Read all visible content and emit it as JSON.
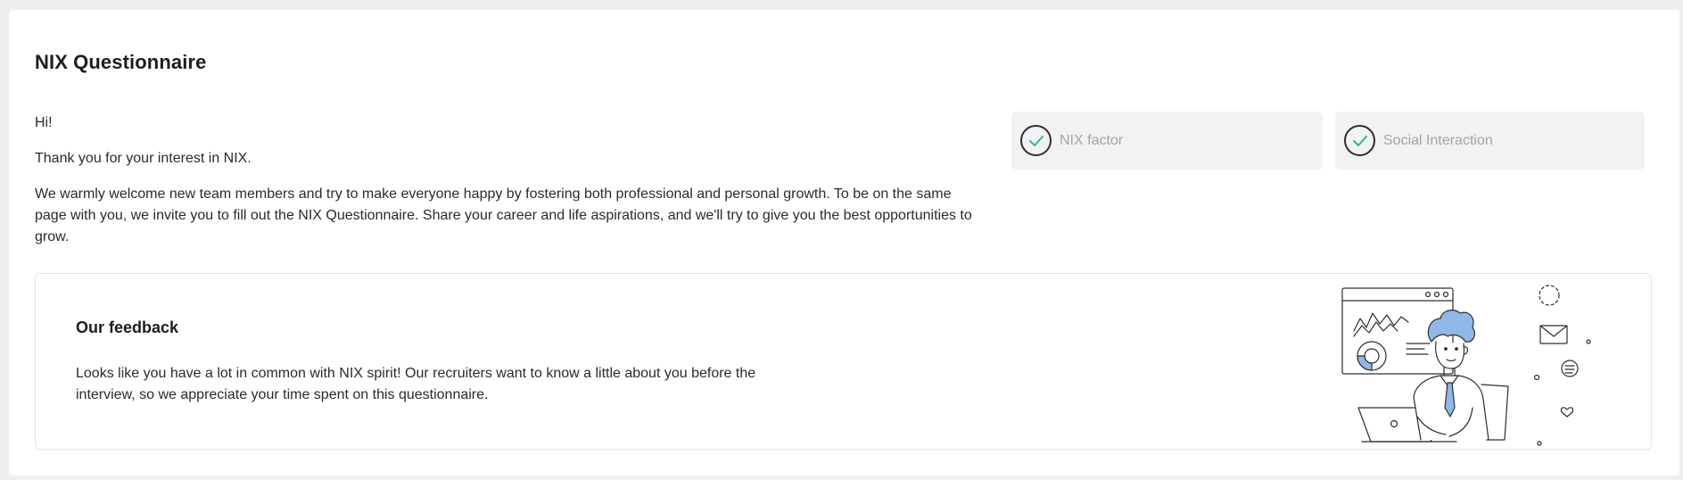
{
  "page": {
    "title": "NIX Questionnaire"
  },
  "intro": {
    "greeting": "Hi!",
    "thanks": "Thank you for your interest in NIX.",
    "body": "We warmly welcome new team members and try to make everyone happy by fostering both professional and personal growth. To be on the same page with you, we invite you to fill out the NIX Questionnaire. Share your career and life aspirations, and we'll try to give you the best opportunities to grow."
  },
  "status_chips": [
    {
      "label": "NIX factor",
      "icon": "check-circle-icon",
      "state": "completed"
    },
    {
      "label": "Social Interaction",
      "icon": "check-circle-icon",
      "state": "completed"
    }
  ],
  "feedback": {
    "title": "Our feedback",
    "text": "Looks like you have a lot in common with NIX spirit! Our recruiters want to know a little about you before the interview, so we appreciate your time spent on this questionnaire.",
    "illustration": "person-at-laptop-illustration"
  },
  "colors": {
    "background": "#efefef",
    "card": "#ffffff",
    "chip_background": "#f2f2f3",
    "check_accent": "#2bb6a0",
    "chip_text": "#a3a3a6",
    "illustration_blue": "#8fb8e8"
  }
}
